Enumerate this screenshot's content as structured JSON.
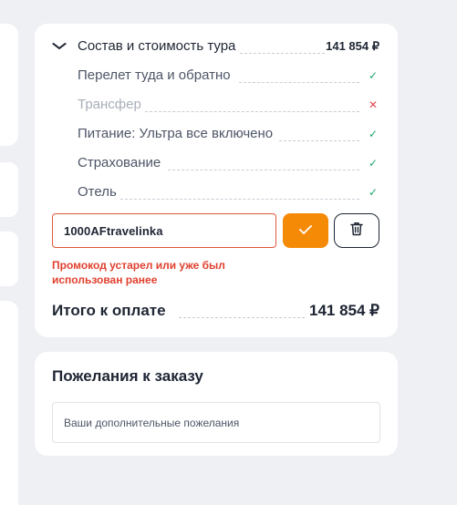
{
  "summary": {
    "title": "Состав и стоимость тура",
    "title_price": "141 854 ₽",
    "chevron_icon": "chevron-down-icon",
    "items": [
      {
        "label": "Перелет туда и обратно",
        "status": "check",
        "mark": "✓"
      },
      {
        "label": "Трансфер",
        "status": "cross",
        "mark": "✕"
      },
      {
        "label": "Питание: Ультра все включено",
        "status": "check",
        "mark": "✓"
      },
      {
        "label": "Страхование",
        "status": "check",
        "mark": "✓"
      },
      {
        "label": "Отель",
        "status": "check",
        "mark": "✓"
      }
    ],
    "promo": {
      "value": "1000AFtravelinka",
      "apply_icon": "check-icon",
      "delete_icon": "trash-icon",
      "error": "Промокод устарел или уже был использован ранее"
    },
    "total_label": "Итого к оплате",
    "total_price": "141 854 ₽"
  },
  "wishes": {
    "title": "Пожелания к заказу",
    "placeholder": "Ваши дополнительные пожелания"
  },
  "colors": {
    "accent": "#f58a07",
    "error": "#e0402e",
    "success": "#1fa86a",
    "background": "#eef0f4"
  }
}
